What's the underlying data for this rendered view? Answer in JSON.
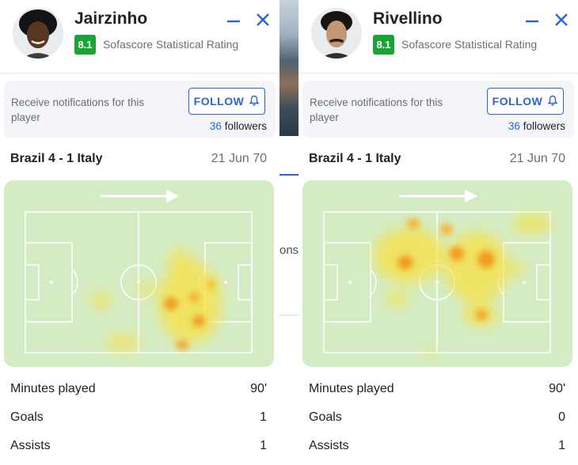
{
  "background": {
    "partial_text": "ons",
    "accent_color": "#2c63d8"
  },
  "colors": {
    "rating_green": "#18a536",
    "link_blue": "#2c63d8",
    "pitch_green": "#d4ecc4"
  },
  "players": [
    {
      "name": "Jairzinho",
      "rating": "8.1",
      "rating_label": "Sofascore Statistical Rating",
      "minimize_icon": "minimize-icon",
      "close_icon": "close-icon",
      "notify_text": "Receive notifications for this player",
      "follow_label": "FOLLOW",
      "follow_icon": "bell-icon",
      "followers_count": "36",
      "followers_label": "followers",
      "match": "Brazil 4 - 1 Italy",
      "date": "21 Jun 70",
      "heatmap_direction_icon": "arrow-right-icon",
      "stats": [
        {
          "label": "Minutes played",
          "value": "90'"
        },
        {
          "label": "Goals",
          "value": "1"
        },
        {
          "label": "Assists",
          "value": "1"
        }
      ]
    },
    {
      "name": "Rivellino",
      "rating": "8.1",
      "rating_label": "Sofascore Statistical Rating",
      "minimize_icon": "minimize-icon",
      "close_icon": "close-icon",
      "notify_text": "Receive notifications for this player",
      "follow_label": "FOLLOW",
      "follow_icon": "bell-icon",
      "followers_count": "36",
      "followers_label": "followers",
      "match": "Brazil 4 - 1 Italy",
      "date": "21 Jun 70",
      "heatmap_direction_icon": "arrow-right-icon",
      "stats": [
        {
          "label": "Minutes played",
          "value": "90'"
        },
        {
          "label": "Goals",
          "value": "0"
        },
        {
          "label": "Assists",
          "value": "1"
        }
      ]
    }
  ]
}
